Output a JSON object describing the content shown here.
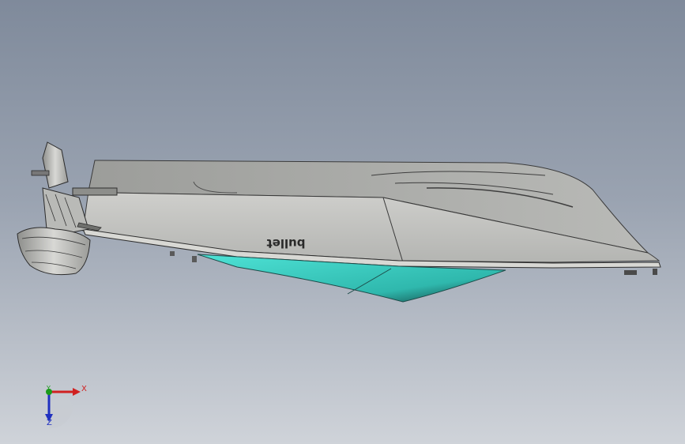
{
  "viewport": {
    "background_top": "#7f8a9b",
    "background_bottom": "#cfd3d9"
  },
  "model": {
    "hull_brand_text": "bullet",
    "hull_color": "#c4c4c0",
    "deck_color": "#a9aaa7",
    "underwater_color": "#3fd6cc"
  },
  "triad": {
    "x_label": "X",
    "y_label": "Y",
    "z_label": "Z",
    "x_color": "#d02020",
    "y_color": "#1a9a1a",
    "z_color": "#2030c0"
  }
}
